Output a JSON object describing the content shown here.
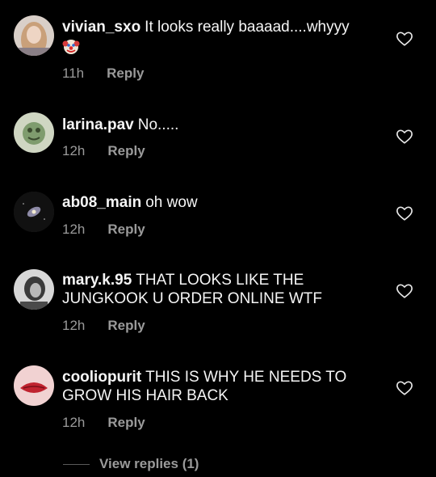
{
  "comments": [
    {
      "username": "vivian_sxo",
      "text": "It looks really baaaad....whyyy",
      "emoji": "clown-emoji",
      "time": "11h",
      "reply": "Reply"
    },
    {
      "username": "larina.pav",
      "text": "No.....",
      "time": "12h",
      "reply": "Reply"
    },
    {
      "username": "ab08_main",
      "text": "oh wow",
      "time": "12h",
      "reply": "Reply"
    },
    {
      "username": "mary.k.95",
      "text": "THAT LOOKS LIKE THE JUNGKOOK U ORDER ONLINE WTF",
      "time": "12h",
      "reply": "Reply"
    },
    {
      "username": "cooliopurit",
      "text": "THIS IS WHY HE NEEDS TO GROW HIS HAIR BACK",
      "time": "12h",
      "reply": "Reply"
    }
  ],
  "view_replies": "View replies (1)",
  "colors": {
    "background": "#000000",
    "text": "#f5f5f5",
    "meta": "#9a9a9a"
  }
}
